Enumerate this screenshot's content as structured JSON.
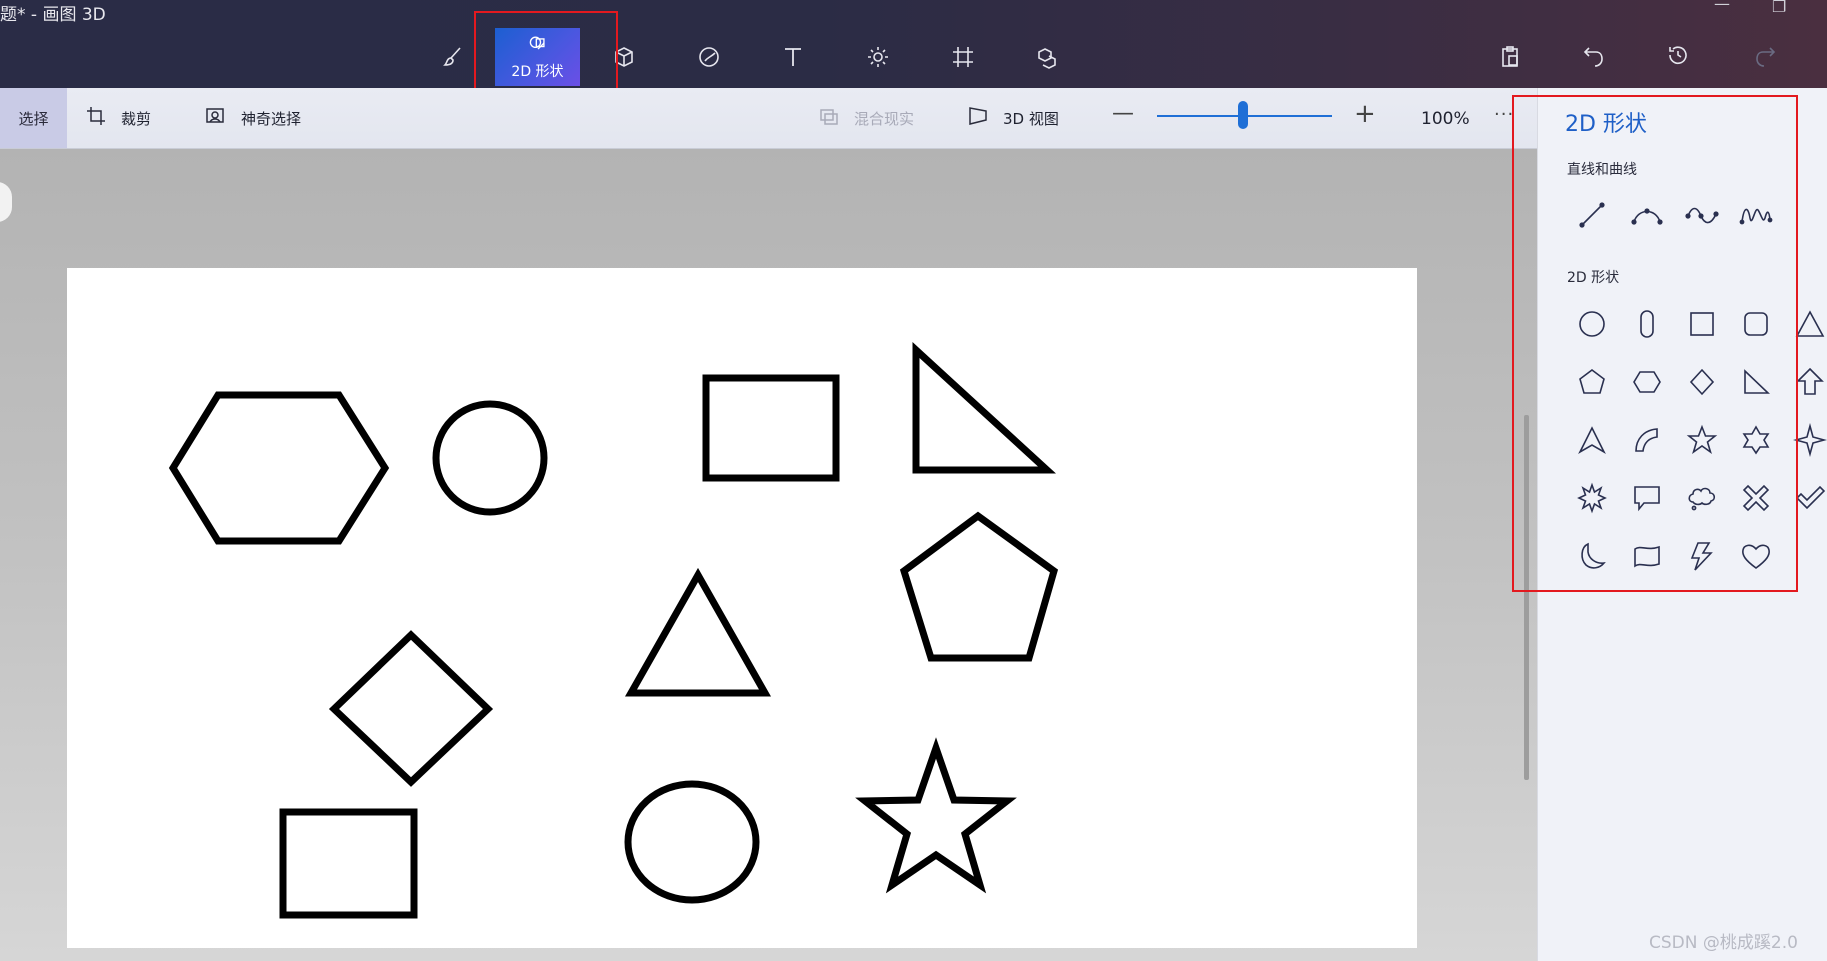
{
  "window": {
    "title": "题* - 画图 3D"
  },
  "top_toolbar": {
    "tools": [
      {
        "name": "brushes",
        "icon": "brush-icon"
      },
      {
        "name": "2d-shapes",
        "icon": "2d-shapes-icon",
        "label": "2D 形状",
        "active": true
      },
      {
        "name": "3d-shapes",
        "icon": "3d-cube-icon"
      },
      {
        "name": "stickers",
        "icon": "sticker-icon"
      },
      {
        "name": "text",
        "icon": "text-icon"
      },
      {
        "name": "effects",
        "icon": "sun-icon"
      },
      {
        "name": "canvas",
        "icon": "canvas-icon"
      },
      {
        "name": "3d-library",
        "icon": "3d-library-icon"
      }
    ],
    "right_tools": [
      {
        "name": "paste",
        "icon": "paste-icon"
      },
      {
        "name": "undo",
        "icon": "undo-icon"
      },
      {
        "name": "history",
        "icon": "history-icon"
      },
      {
        "name": "redo",
        "icon": "redo-icon",
        "disabled": true
      }
    ]
  },
  "secondary_toolbar": {
    "select_label": "选择",
    "crop_label": "裁剪",
    "magic_select_label": "神奇选择",
    "mixed_reality_label": "混合现实",
    "view_3d_label": "3D 视图",
    "zoom": {
      "percent_label": "100%",
      "level": 0.5
    },
    "more_label": "···"
  },
  "canvas": {
    "shapes": [
      "hexagon",
      "circle",
      "rectangle",
      "right-triangle",
      "diamond",
      "triangle",
      "pentagon",
      "rectangle",
      "ellipse",
      "star"
    ]
  },
  "side_panel": {
    "title": "2D 形状",
    "lines_section_label": "直线和曲线",
    "lines": [
      "line-icon",
      "curve-icon",
      "two-point-curve-icon",
      "three-point-curve-icon"
    ],
    "shapes_section_label": "2D 形状",
    "shapes": [
      [
        "circle-icon",
        "capsule-icon",
        "square-icon",
        "rounded-square-icon",
        "triangle-icon"
      ],
      [
        "pentagon-icon",
        "hexagon-icon",
        "diamond-icon",
        "right-triangle-icon",
        "arrow-up-icon"
      ],
      [
        "arrowhead-icon",
        "quarter-circle-icon",
        "five-point-star-icon",
        "six-point-star-icon",
        "four-point-star-icon"
      ],
      [
        "burst-icon",
        "speech-bubble-icon",
        "thought-bubble-icon",
        "x-mark-icon",
        "checkmark-icon"
      ],
      [
        "moon-icon",
        "banner-icon",
        "lightning-icon",
        "heart-icon"
      ]
    ]
  },
  "watermark": "CSDN @桃成蹊2.0",
  "colors": {
    "accent": "#1f6fd6",
    "annotation_red": "#e3191f",
    "titlebar": "#2b2c45"
  }
}
